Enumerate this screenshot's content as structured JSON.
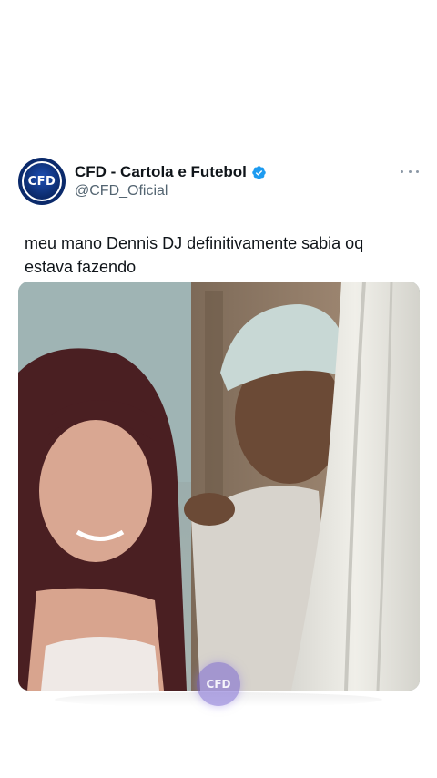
{
  "tweet": {
    "author": {
      "display_name": "CFD - Cartola e Futebol",
      "handle": "@CFD_Oficial",
      "avatar_text": "CFD",
      "verified": true,
      "verified_color": "#1d9bf0"
    },
    "text": "meu mano Dennis DJ definitivamente sabia oq estava fazendo",
    "more_icon": "more-horizontal-icon",
    "media": {
      "type": "video-still",
      "watermark_text": "CFD"
    }
  },
  "colors": {
    "avatar_bg": "#0b2a6b",
    "text_primary": "#0f1419",
    "text_secondary": "#536471"
  }
}
